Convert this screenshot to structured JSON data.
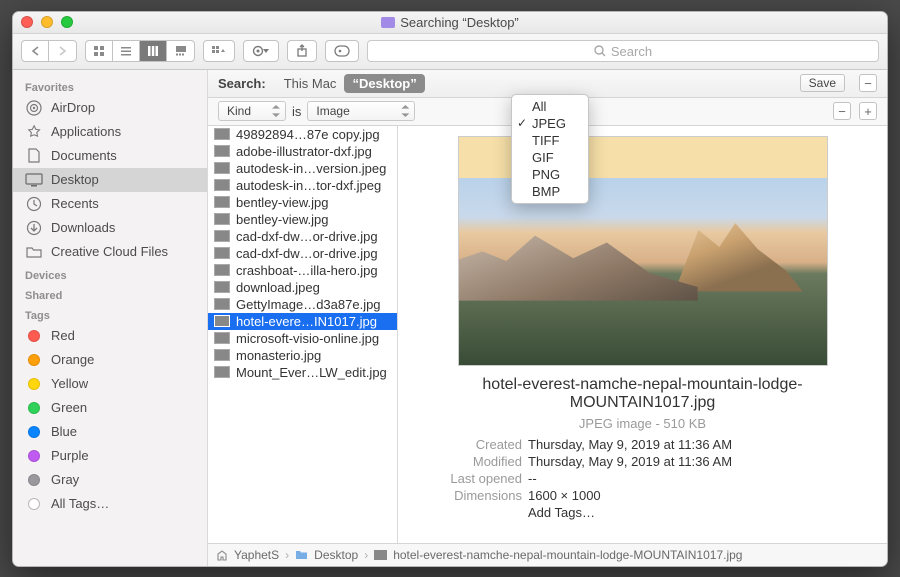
{
  "window_title": "Searching “Desktop”",
  "search_placeholder": "Search",
  "sidebar": {
    "favorites_h": "Favorites",
    "devices_h": "Devices",
    "shared_h": "Shared",
    "tags_h": "Tags",
    "items": [
      "AirDrop",
      "Applications",
      "Documents",
      "Desktop",
      "Recents",
      "Downloads",
      "Creative Cloud Files"
    ],
    "tags": [
      {
        "label": "Red",
        "color": "#ff5b51"
      },
      {
        "label": "Orange",
        "color": "#ff9f0a"
      },
      {
        "label": "Yellow",
        "color": "#ffd60a"
      },
      {
        "label": "Green",
        "color": "#30d158"
      },
      {
        "label": "Blue",
        "color": "#0a84ff"
      },
      {
        "label": "Purple",
        "color": "#bf5af2"
      },
      {
        "label": "Gray",
        "color": "#98989d"
      }
    ],
    "all_tags": "All Tags…"
  },
  "searchbar": {
    "label": "Search:",
    "scope1": "This Mac",
    "scope2": "“Desktop”",
    "save": "Save"
  },
  "criteria": {
    "attr": "Kind",
    "op": "is",
    "val": "Image"
  },
  "dropdown": [
    "All",
    "JPEG",
    "TIFF",
    "GIF",
    "PNG",
    "BMP"
  ],
  "files": [
    "49892894…87e copy.jpg",
    "adobe-illustrator-dxf.jpg",
    "autodesk-in…version.jpeg",
    "autodesk-in…tor-dxf.jpeg",
    "bentley-view.jpg",
    "bentley-view.jpg",
    "cad-dxf-dw…or-drive.jpg",
    "cad-dxf-dw…or-drive.jpg",
    "crashboat-…illa-hero.jpg",
    "download.jpeg",
    "GettyImage…d3a87e.jpg",
    "hotel-evere…IN1017.jpg",
    "microsoft-visio-online.jpg",
    "monasterio.jpg",
    "Mount_Ever…LW_edit.jpg"
  ],
  "preview": {
    "name": "hotel-everest-namche-nepal-mountain-lodge-MOUNTAIN1017.jpg",
    "type": "JPEG image - 510 KB",
    "created_k": "Created",
    "created_v": "Thursday, May 9, 2019 at 11:36 AM",
    "modified_k": "Modified",
    "modified_v": "Thursday, May 9, 2019 at 11:36 AM",
    "lastopen_k": "Last opened",
    "lastopen_v": "--",
    "dim_k": "Dimensions",
    "dim_v": "1600 × 1000",
    "addtags": "Add Tags…"
  },
  "path": {
    "user": "YaphetS",
    "folder": "Desktop",
    "file": "hotel-everest-namche-nepal-mountain-lodge-MOUNTAIN1017.jpg"
  }
}
